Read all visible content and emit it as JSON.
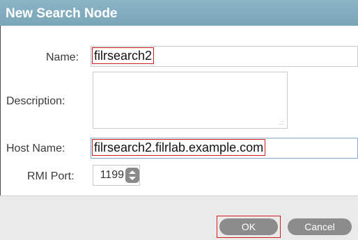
{
  "dialog": {
    "title": "New Search Node"
  },
  "form": {
    "name_label": "Name:",
    "name_value": "filrsearch2",
    "description_label": "Description:",
    "description_value": "",
    "host_label": "Host Name:",
    "host_value": "filrsearch2.filrlab.example.com",
    "rmi_label": "RMI Port:",
    "rmi_value": "1199"
  },
  "buttons": {
    "ok": "OK",
    "cancel": "Cancel"
  },
  "colors": {
    "titlebar": "#7aa6b9",
    "highlight_outline": "#d11a1a",
    "button": "#8c8c8c",
    "footer": "#eaeaea"
  }
}
